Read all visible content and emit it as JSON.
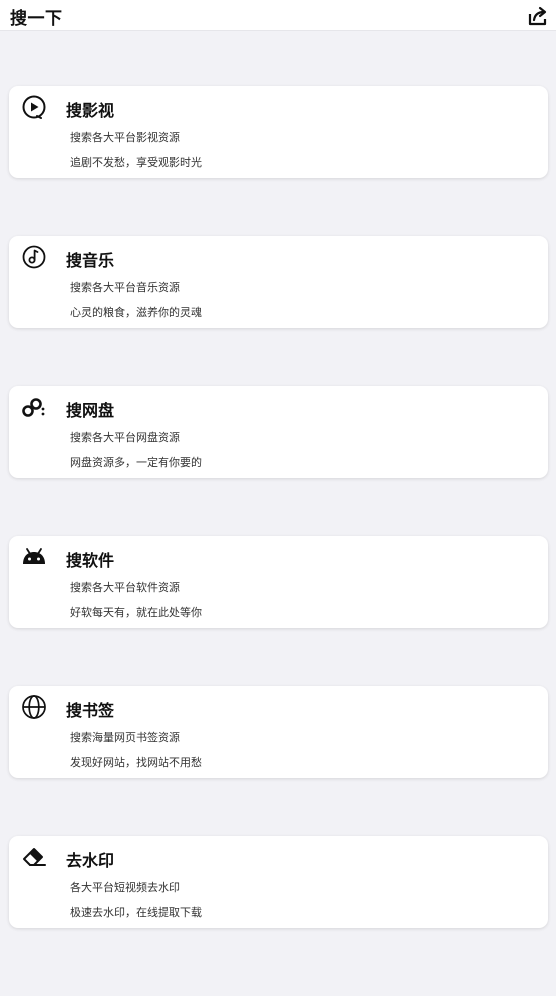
{
  "header": {
    "title": "搜一下",
    "share_icon": "share-icon"
  },
  "cards": [
    {
      "title": "搜影视",
      "line1": "搜索各大平台影视资源",
      "line2": "追剧不发愁，享受观影时光",
      "icon": "play-circle-icon"
    },
    {
      "title": "搜音乐",
      "line1": "搜索各大平台音乐资源",
      "line2": "心灵的粮食，滋养你的灵魂",
      "icon": "music-note-icon"
    },
    {
      "title": "搜网盘",
      "line1": "搜索各大平台网盘资源",
      "line2": "网盘资源多，一定有你要的",
      "icon": "cloud-link-icon"
    },
    {
      "title": "搜软件",
      "line1": "搜索各大平台软件资源",
      "line2": "好软每天有，就在此处等你",
      "icon": "android-icon"
    },
    {
      "title": "搜书签",
      "line1": "搜索海量网页书签资源",
      "line2": "发现好网站，找网站不用愁",
      "icon": "globe-icon"
    },
    {
      "title": "去水印",
      "line1": "各大平台短视频去水印",
      "line2": "极速去水印，在线提取下载",
      "icon": "eraser-icon"
    }
  ]
}
